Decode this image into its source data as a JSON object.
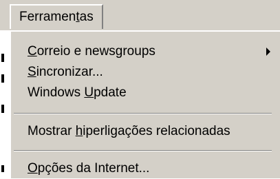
{
  "menu": {
    "title": {
      "before": "Ferramen",
      "accel": "t",
      "after": "as"
    },
    "items": [
      {
        "before": "",
        "accel": "C",
        "after": "orreio e newsgroups",
        "has_submenu": true
      },
      {
        "before": "",
        "accel": "S",
        "after": "incronizar...",
        "has_submenu": false
      },
      {
        "before": "Windows ",
        "accel": "U",
        "after": "pdate",
        "has_submenu": false
      },
      {
        "before": "Mostrar ",
        "accel": "h",
        "after": "iperligações relacionadas",
        "has_submenu": false
      },
      {
        "before": "",
        "accel": "O",
        "after": "pções da Internet...",
        "has_submenu": false
      }
    ]
  },
  "icons": {
    "submenu_arrow": "chevron-right-icon"
  },
  "colors": {
    "menu_face": "#d4d0c8",
    "highlight": "#ffffff",
    "shadow": "#808080",
    "text": "#000000",
    "background": "#ffffff",
    "accent_line": "#c00000"
  }
}
